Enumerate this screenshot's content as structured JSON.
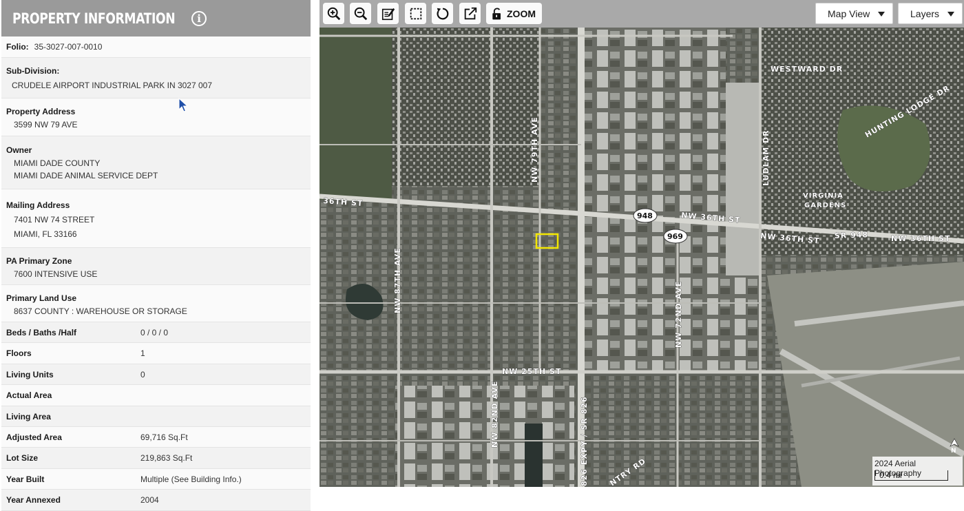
{
  "panel": {
    "title": "PROPERTY INFORMATION",
    "folio": {
      "label": "Folio:",
      "value": "35-3027-007-0010"
    },
    "subdivision": {
      "label": "Sub-Division:",
      "value": "CRUDELE AIRPORT INDUSTRIAL PARK IN 3027 007"
    },
    "property_address": {
      "label": "Property Address",
      "value": "3599 NW 79 AVE"
    },
    "owner": {
      "label": "Owner",
      "lines": [
        "MIAMI DADE COUNTY",
        "MIAMI DADE ANIMAL SERVICE DEPT"
      ]
    },
    "mailing_address": {
      "label": "Mailing Address",
      "lines": [
        "7401 NW 74 STREET",
        "MIAMI, FL 33166"
      ]
    },
    "pa_zone": {
      "label": "PA Primary Zone",
      "value": "7600 INTENSIVE USE"
    },
    "land_use": {
      "label": "Primary Land Use",
      "value": "8637 COUNTY : WAREHOUSE OR STORAGE"
    },
    "facts": [
      {
        "label": "Beds / Baths /Half",
        "value": "0 / 0 / 0"
      },
      {
        "label": "Floors",
        "value": "1"
      },
      {
        "label": "Living Units",
        "value": "0"
      },
      {
        "label": "Actual Area",
        "value": ""
      },
      {
        "label": "Living Area",
        "value": ""
      },
      {
        "label": "Adjusted Area",
        "value": "69,716 Sq.Ft"
      },
      {
        "label": "Lot Size",
        "value": "219,863 Sq.Ft"
      },
      {
        "label": "Year Built",
        "value": "Multiple (See Building Info.)"
      },
      {
        "label": "Year Annexed",
        "value": "2004"
      }
    ]
  },
  "toolbar": {
    "buttons": [
      "zoom-in-icon",
      "zoom-out-icon",
      "edit-icon",
      "select-box-icon",
      "refresh-icon",
      "external-link-icon",
      "unlock-icon"
    ],
    "zoom_label": "ZOOM",
    "map_view_label": "Map View",
    "layers_label": "Layers"
  },
  "map": {
    "streets": {
      "westward": "WESTWARD DR",
      "hunting": "HUNTING LODGE DR",
      "ludlam": "LUDLAM DR",
      "nw79": "NW 79TH AVE",
      "nw36_left": "36TH ST",
      "nw36_mid": "NW 36TH ST",
      "nw36_right": "NW 36TH ST",
      "sr948": "SR 948",
      "nw36_far": "NW 36TH ST",
      "nw87": "NW 87TH AVE",
      "nw72": "NW 72ND AVE",
      "nw25": "NW 25TH ST",
      "nw82": "NW 82ND AVE",
      "sr826": "826 EXPY / SR 826",
      "country": "NTRY RD",
      "virginia": "VIRGINIA",
      "gardens": "GARDENS"
    },
    "shields": [
      "948",
      "969"
    ],
    "attribution": "2024 Aerial Photography",
    "scale": "0.4 mi",
    "north": "N",
    "colors": {
      "parcel_highlight": "#f2e600",
      "toolbar_bg": "#a9a9a9",
      "header_bg": "#9a9a9a"
    }
  }
}
